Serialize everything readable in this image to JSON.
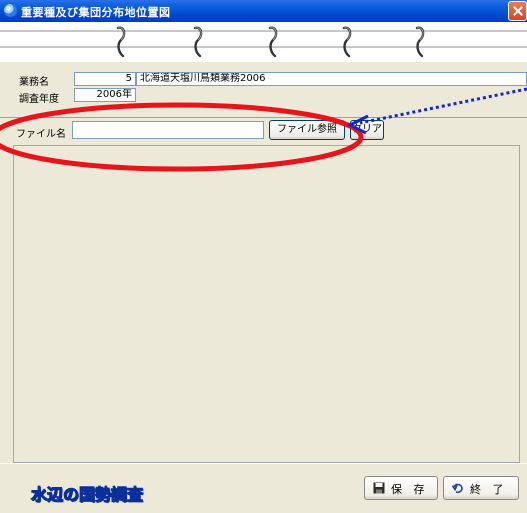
{
  "window": {
    "title": "重要種及び集団分布地位置図"
  },
  "header": {
    "business_label": "業務名",
    "business_number": "5",
    "business_name": "北海道天塩川鳥類業務2006",
    "survey_year_label": "調査年度",
    "survey_year_value": "2006年"
  },
  "file_row": {
    "label": "ファイル名",
    "input_value": "",
    "browse_button": "ファイル参照",
    "clear_button": "クリア"
  },
  "footer": {
    "logo_text": "水辺の国勢調査",
    "save_button": "保 存",
    "exit_button": "終 了"
  },
  "annotation": {
    "ellipse_color": "#e8141a",
    "arrow_color": "#1428c8"
  }
}
